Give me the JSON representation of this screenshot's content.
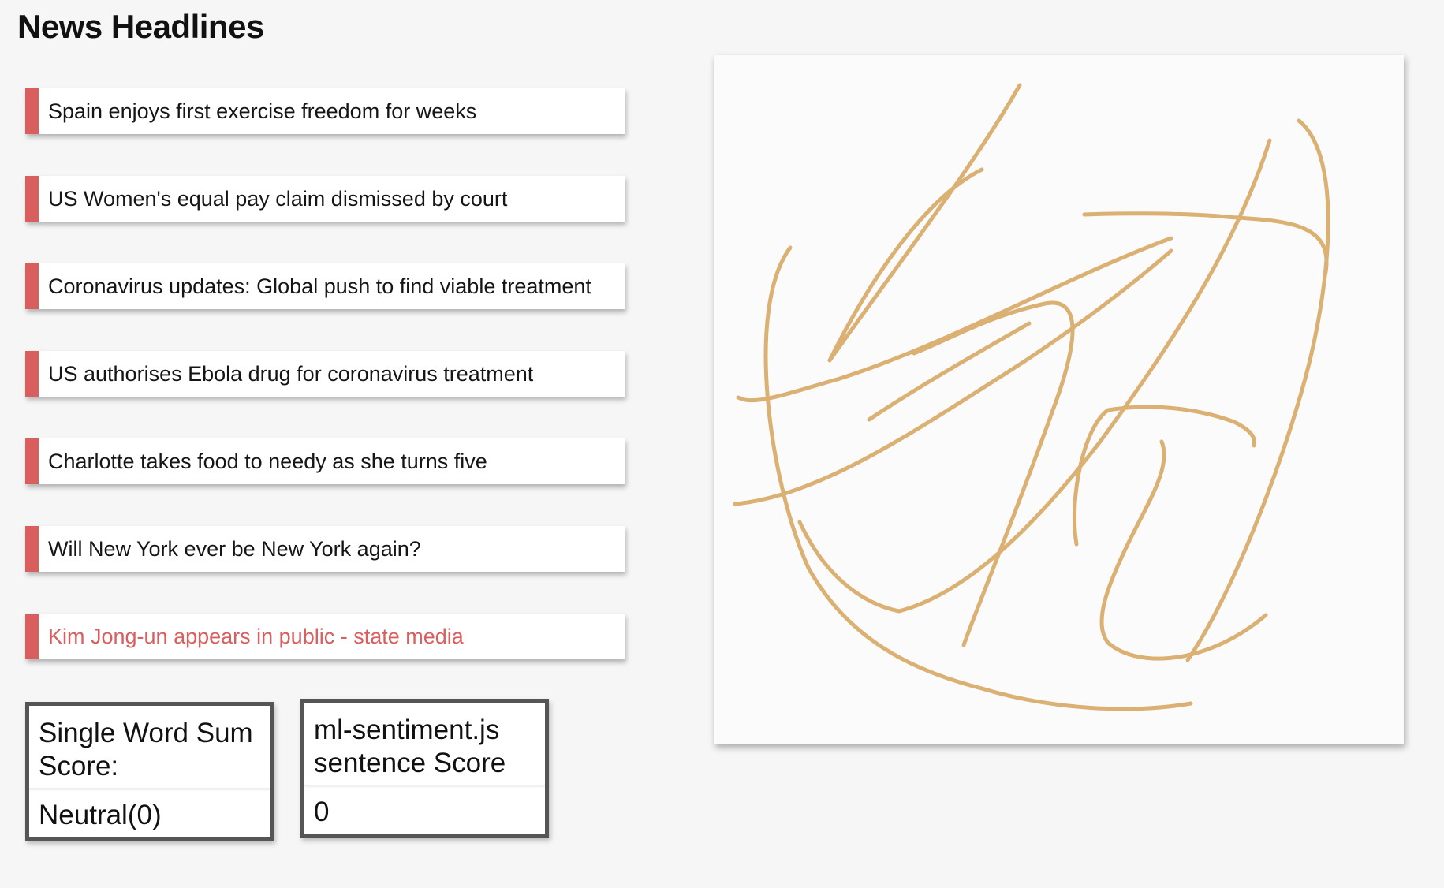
{
  "page": {
    "title": "News Headlines"
  },
  "headlines": [
    {
      "text": "Spain enjoys first exercise freedom for weeks",
      "active": false
    },
    {
      "text": "US Women's equal pay claim dismissed by court",
      "active": false
    },
    {
      "text": "Coronavirus updates: Global push to find viable treatment",
      "active": false
    },
    {
      "text": "US authorises Ebola drug for coronavirus treatment",
      "active": false
    },
    {
      "text": "Charlotte takes food to needy as she turns five",
      "active": false
    },
    {
      "text": "Will New York ever be New York again?",
      "active": false
    },
    {
      "text": "Kim Jong-un appears in public - state media",
      "active": true
    }
  ],
  "scores": {
    "word_sum": {
      "title": "Single Word Sum Score:",
      "value": "Neutral(0)"
    },
    "ml_sentiment": {
      "title": "ml-sentiment.js sentence Score",
      "value": "0"
    }
  },
  "colors": {
    "accent": "#d95f5f",
    "stroke": "#dbb073",
    "background": "#f6f6f6",
    "card": "#ffffff",
    "box_border": "#555555"
  }
}
